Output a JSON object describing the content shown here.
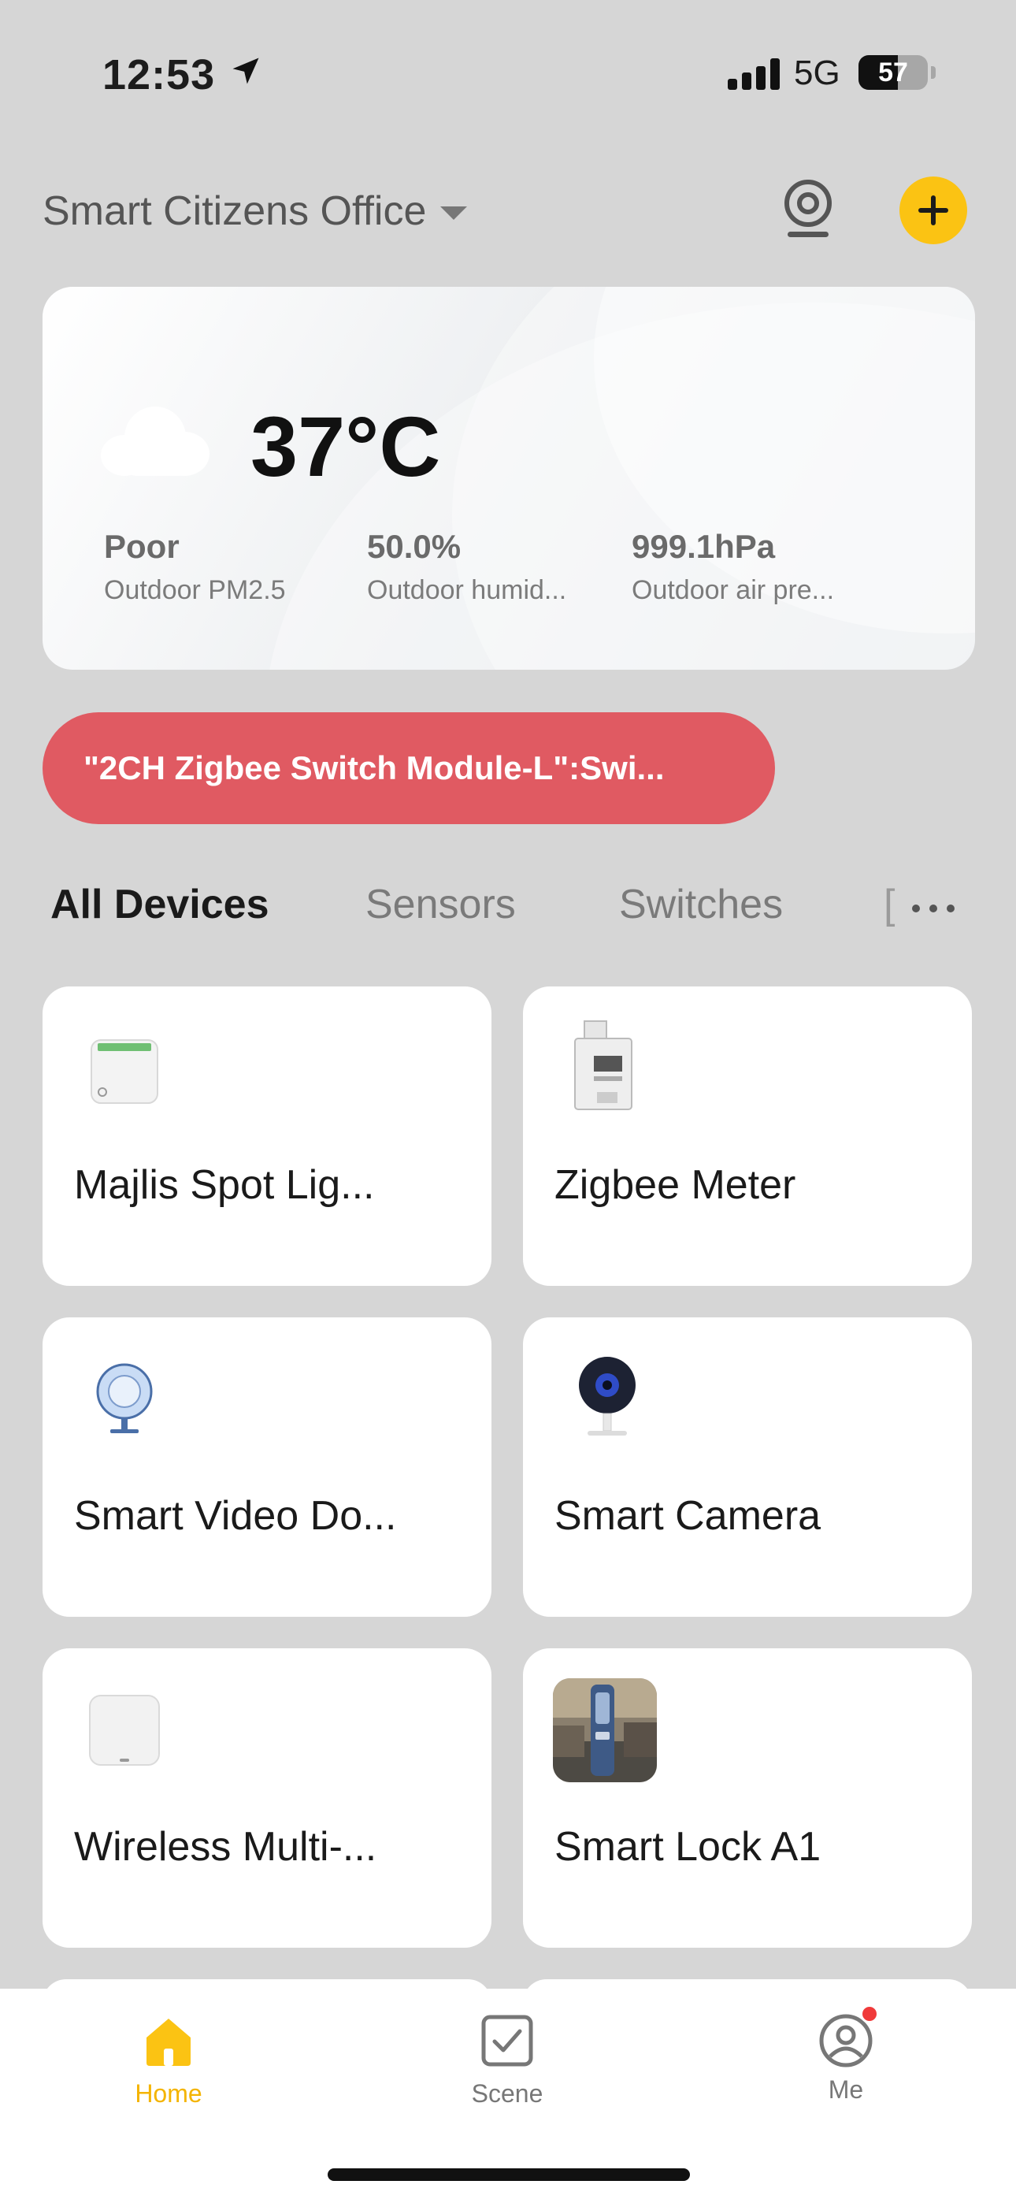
{
  "status_bar": {
    "time": "12:53",
    "network": "5G",
    "battery_level": "57"
  },
  "header": {
    "home_name": "Smart Citizens Office"
  },
  "weather": {
    "temperature": "37°C",
    "metrics": [
      {
        "value": "Poor",
        "label": "Outdoor PM2.5"
      },
      {
        "value": "50.0%",
        "label": "Outdoor humid..."
      },
      {
        "value": "999.1hPa",
        "label": "Outdoor air pre..."
      }
    ]
  },
  "alert": {
    "text": "\"2CH Zigbee Switch Module-L\":Swi..."
  },
  "tabs": [
    {
      "label": "All Devices",
      "active": true
    },
    {
      "label": "Sensors",
      "active": false
    },
    {
      "label": "Switches",
      "active": false
    }
  ],
  "tab_overflow_hint": "[",
  "devices": [
    {
      "name": "Majlis Spot Lig...",
      "icon": "switch-module-icon"
    },
    {
      "name": "Zigbee Meter",
      "icon": "din-meter-icon"
    },
    {
      "name": "Smart Video Do...",
      "icon": "video-doorbell-icon"
    },
    {
      "name": "Smart  Camera",
      "icon": "camera-icon"
    },
    {
      "name": "Wireless Multi-...",
      "icon": "hub-icon"
    },
    {
      "name": "Smart Lock A1",
      "icon": "lock-photo-icon"
    }
  ],
  "bottom_nav": [
    {
      "label": "Home",
      "active": true
    },
    {
      "label": "Scene",
      "active": false
    },
    {
      "label": "Me",
      "active": false
    }
  ],
  "colors": {
    "accent": "#fbc313",
    "alert": "#e05a62",
    "background": "#d6d6d6"
  }
}
